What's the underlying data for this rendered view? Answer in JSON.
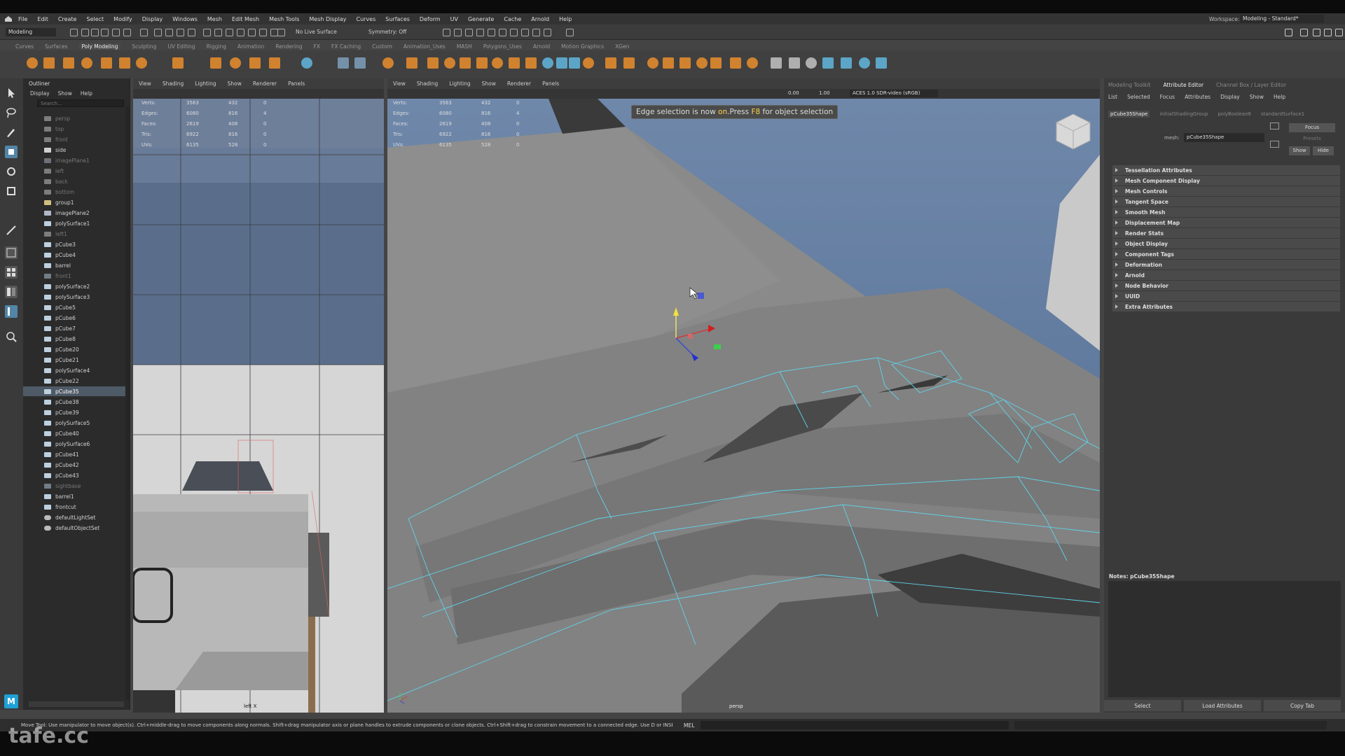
{
  "menubar": {
    "items": [
      "File",
      "Edit",
      "Create",
      "Select",
      "Modify",
      "Display",
      "Windows",
      "Mesh",
      "Edit Mesh",
      "Mesh Tools",
      "Mesh Display",
      "Curves",
      "Surfaces",
      "Deform",
      "UV",
      "Generate",
      "Cache",
      "Arnold",
      "Help"
    ],
    "workspace_label": "Workspace:",
    "workspace_value": "Modeling - Standard*"
  },
  "statusline": {
    "mode": "Modeling",
    "live_surface": "No Live Surface",
    "symmetry": "Symmetry: Off"
  },
  "shelf": {
    "tabs": [
      "Curves",
      "Surfaces",
      "Poly Modeling",
      "Sculpting",
      "UV Editing",
      "Rigging",
      "Animation",
      "Rendering",
      "FX",
      "FX Caching",
      "Custom",
      "Animation_Uses",
      "MASH",
      "Polygons_Uses",
      "Arnold",
      "Motion Graphics",
      "XGen"
    ],
    "active_tab": "Poly Modeling"
  },
  "outliner": {
    "title": "Outliner",
    "menu": [
      "Display",
      "Show",
      "Help"
    ],
    "search_placeholder": "Search...",
    "items": [
      {
        "name": "persp",
        "dim": true,
        "type": "camera"
      },
      {
        "name": "top",
        "dim": true,
        "type": "camera"
      },
      {
        "name": "front",
        "dim": true,
        "type": "camera"
      },
      {
        "name": "side",
        "dim": false,
        "type": "camera"
      },
      {
        "name": "imagePlane1",
        "dim": true,
        "type": "image"
      },
      {
        "name": "left",
        "dim": true,
        "type": "camera"
      },
      {
        "name": "back",
        "dim": true,
        "type": "camera"
      },
      {
        "name": "bottom",
        "dim": true,
        "type": "camera"
      },
      {
        "name": "group1",
        "dim": false,
        "type": "group"
      },
      {
        "name": "imagePlane2",
        "dim": false,
        "type": "image"
      },
      {
        "name": "polySurface1",
        "dim": false,
        "type": "mesh"
      },
      {
        "name": "left1",
        "dim": true,
        "type": "camera"
      },
      {
        "name": "pCube3",
        "dim": false,
        "type": "mesh"
      },
      {
        "name": "pCube4",
        "dim": false,
        "type": "mesh"
      },
      {
        "name": "barrel",
        "dim": false,
        "type": "mesh"
      },
      {
        "name": "front1",
        "dim": true,
        "type": "mesh"
      },
      {
        "name": "polySurface2",
        "dim": false,
        "type": "mesh"
      },
      {
        "name": "polySurface3",
        "dim": false,
        "type": "mesh"
      },
      {
        "name": "pCube5",
        "dim": false,
        "type": "mesh"
      },
      {
        "name": "pCube6",
        "dim": false,
        "type": "mesh"
      },
      {
        "name": "pCube7",
        "dim": false,
        "type": "mesh"
      },
      {
        "name": "pCube8",
        "dim": false,
        "type": "mesh"
      },
      {
        "name": "pCube20",
        "dim": false,
        "type": "mesh"
      },
      {
        "name": "pCube21",
        "dim": false,
        "type": "mesh"
      },
      {
        "name": "polySurface4",
        "dim": false,
        "type": "mesh"
      },
      {
        "name": "pCube22",
        "dim": false,
        "type": "mesh"
      },
      {
        "name": "pCube35",
        "dim": false,
        "type": "mesh",
        "selected": true
      },
      {
        "name": "pCube38",
        "dim": false,
        "type": "mesh"
      },
      {
        "name": "pCube39",
        "dim": false,
        "type": "mesh"
      },
      {
        "name": "polySurface5",
        "dim": false,
        "type": "mesh"
      },
      {
        "name": "pCube40",
        "dim": false,
        "type": "mesh"
      },
      {
        "name": "polySurface6",
        "dim": false,
        "type": "mesh"
      },
      {
        "name": "pCube41",
        "dim": false,
        "type": "mesh"
      },
      {
        "name": "pCube42",
        "dim": false,
        "type": "mesh"
      },
      {
        "name": "pCube43",
        "dim": false,
        "type": "mesh"
      },
      {
        "name": "sightbase",
        "dim": true,
        "type": "mesh"
      },
      {
        "name": "barrel1",
        "dim": false,
        "type": "mesh"
      },
      {
        "name": "frontcut",
        "dim": false,
        "type": "mesh"
      },
      {
        "name": "defaultLightSet",
        "dim": false,
        "type": "set"
      },
      {
        "name": "defaultObjectSet",
        "dim": false,
        "type": "set"
      }
    ]
  },
  "viewport_menu": [
    "View",
    "Shading",
    "Lighting",
    "Show",
    "Renderer",
    "Panels"
  ],
  "hud": {
    "labels": [
      "Verts:",
      "Edges:",
      "Faces:",
      "Tris:",
      "UVs:"
    ],
    "col1": [
      "3563",
      "6080",
      "2619",
      "6922",
      "6135"
    ],
    "col2": [
      "432",
      "816",
      "408",
      "816",
      "528"
    ],
    "col3": [
      "0",
      "4",
      "0",
      "0",
      "0"
    ]
  },
  "left_view_label": "left X",
  "persp_view_label": "persp",
  "persp_toolbar": {
    "exposure": "0.00",
    "gamma": "1.00",
    "colorspace": "ACES 1.0 SDR-video (sRGB)"
  },
  "notification": {
    "before": "Edge selection is now ",
    "on": "on",
    "mid": ".Press ",
    "key": "F8",
    "after": " for object selection"
  },
  "attribute_editor": {
    "top_tabs": [
      "Modeling Toolkit",
      "Attribute Editor",
      "Channel Box / Layer Editor"
    ],
    "active_tab": "Attribute Editor",
    "menu": [
      "List",
      "Selected",
      "Focus",
      "Attributes",
      "Display",
      "Show",
      "Help"
    ],
    "node_tabs": [
      "pCube35Shape",
      "initialShadingGroup",
      "polyBoolean6",
      "standardSurface1"
    ],
    "mesh_label": "mesh:",
    "mesh_value": "pCube35Shape",
    "btn_focus": "Focus",
    "btn_presets": "Presets",
    "btn_show": "Show",
    "btn_hide": "Hide",
    "sections": [
      "Tessellation Attributes",
      "Mesh Component Display",
      "Mesh Controls",
      "Tangent Space",
      "Smooth Mesh",
      "Displacement Map",
      "Render Stats",
      "Object Display",
      "Component Tags",
      "Deformation",
      "Arnold",
      "Node Behavior",
      "UUID",
      "Extra Attributes"
    ],
    "notes_label": "Notes: pCube35Shape",
    "bottom_buttons": [
      "Select",
      "Load Attributes",
      "Copy Tab"
    ]
  },
  "helpline": {
    "text": "Move Tool: Use manipulator to move object(s). Ctrl+middle-drag to move components along normals. Shift+drag manipulator axis or plane handles to extrude components or clone objects. Ctrl+Shift+drag to constrain movement to a connected edge. Use D or INSERT to change th",
    "mel": "MEL"
  },
  "watermark": "tafe.cc",
  "colors": {
    "accent_orange": "#e08a2e",
    "selection_blue": "#4e5a66",
    "wire_cyan": "#5fd4ea",
    "notification_yellow": "#ffd24a"
  }
}
